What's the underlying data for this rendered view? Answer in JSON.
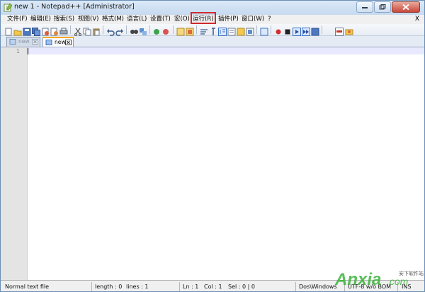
{
  "window": {
    "title": "new  1 - Notepad++ [Administrator]"
  },
  "menu": {
    "items": [
      "文件(F)",
      "编辑(E)",
      "搜索(S)",
      "视图(V)",
      "格式(M)",
      "语言(L)",
      "设置(T)",
      "宏(O)",
      "运行(R)",
      "插件(P)",
      "窗口(W)",
      "?"
    ],
    "close_label": "X",
    "highlighted": "运行(R)"
  },
  "tabs": [
    {
      "label": "new",
      "active": false
    },
    {
      "label": "new",
      "active": true
    }
  ],
  "editor": {
    "line_numbers": [
      "1"
    ],
    "content": ""
  },
  "status": {
    "file_type": "Normal text file",
    "length": "length : 0",
    "lines": "lines : 1",
    "ln": "Ln : 1",
    "col": "Col : 1",
    "sel": "Sel : 0 | 0",
    "eol": "Dos\\Windows",
    "encoding": "UTF-8 w/o BOM",
    "mode": "INS"
  },
  "watermark": {
    "brand": "Anxia",
    "domain": ".com",
    "tagline": "安下软件站"
  },
  "colors": {
    "highlight": "#d22a2a",
    "active_tab_accent": "#f5a623",
    "watermark_green": "#3cb43c"
  }
}
